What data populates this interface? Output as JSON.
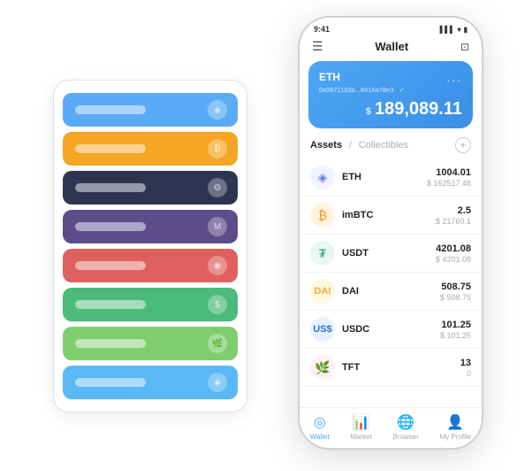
{
  "app": {
    "title": "Wallet"
  },
  "status_bar": {
    "time": "9:41",
    "signal": "▌▌▌",
    "wifi": "WiFi",
    "battery": "🔋"
  },
  "header": {
    "menu_icon": "☰",
    "title": "Wallet",
    "scan_icon": "⊡"
  },
  "balance_card": {
    "coin": "ETH",
    "address": "0x08711d3b...8416a78e3",
    "checkmark": "✓",
    "more_icon": "...",
    "currency_symbol": "$",
    "amount": "189,089.11"
  },
  "assets_header": {
    "active_tab": "Assets",
    "divider": "/",
    "inactive_tab": "Collectibles",
    "add_icon": "+"
  },
  "assets": [
    {
      "name": "ETH",
      "icon": "◈",
      "icon_class": "eth-icon",
      "amount": "1004.01",
      "usd": "$ 162517.48"
    },
    {
      "name": "imBTC",
      "icon": "₿",
      "icon_class": "imbtc-icon",
      "amount": "2.5",
      "usd": "$ 21760.1"
    },
    {
      "name": "USDT",
      "icon": "₮",
      "icon_class": "usdt-icon",
      "amount": "4201.08",
      "usd": "$ 4201.08"
    },
    {
      "name": "DAI",
      "icon": "◉",
      "icon_class": "dai-icon",
      "amount": "508.75",
      "usd": "$ 508.75"
    },
    {
      "name": "USDC",
      "icon": "$",
      "icon_class": "usdc-icon",
      "amount": "101.25",
      "usd": "$ 101.25"
    },
    {
      "name": "TFT",
      "icon": "🌿",
      "icon_class": "tft-icon",
      "amount": "13",
      "usd": "0"
    }
  ],
  "bottom_nav": [
    {
      "label": "Wallet",
      "icon": "◎",
      "active": true
    },
    {
      "label": "Market",
      "icon": "📊",
      "active": false
    },
    {
      "label": "Browser",
      "icon": "🌐",
      "active": false
    },
    {
      "label": "My Profile",
      "icon": "👤",
      "active": false
    }
  ],
  "card_stack": [
    {
      "color": "card-blue"
    },
    {
      "color": "card-orange"
    },
    {
      "color": "card-dark"
    },
    {
      "color": "card-purple"
    },
    {
      "color": "card-red"
    },
    {
      "color": "card-green"
    },
    {
      "color": "card-lightgreen"
    },
    {
      "color": "card-lightblue"
    }
  ]
}
